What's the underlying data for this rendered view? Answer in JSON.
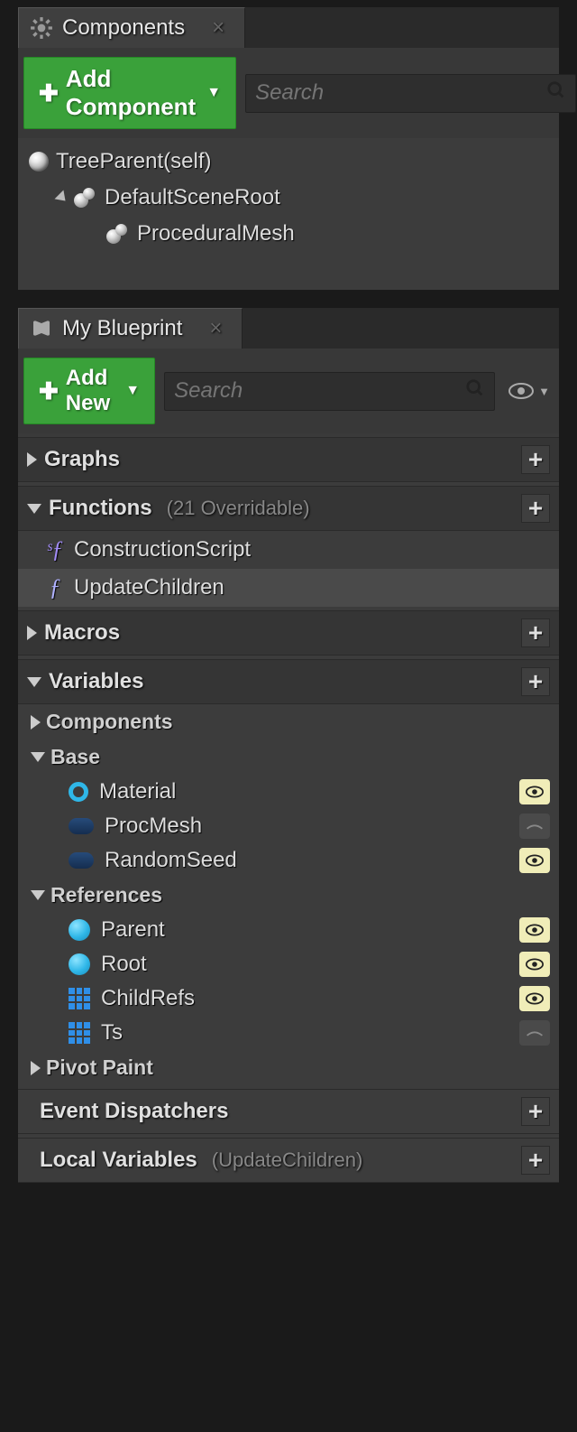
{
  "components_panel": {
    "tab_label": "Components",
    "add_button": "Add Component",
    "search_placeholder": "Search",
    "tree": {
      "root": "TreeParent(self)",
      "scene_root": "DefaultSceneRoot",
      "child": "ProceduralMesh"
    }
  },
  "blueprint_panel": {
    "tab_label": "My Blueprint",
    "add_button": "Add New",
    "search_placeholder": "Search",
    "sections": {
      "graphs": {
        "label": "Graphs"
      },
      "functions": {
        "label": "Functions",
        "meta": "(21 Overridable)",
        "items": [
          {
            "name": "ConstructionScript",
            "icon": "construct"
          },
          {
            "name": "UpdateChildren",
            "icon": "fn"
          }
        ]
      },
      "macros": {
        "label": "Macros"
      },
      "variables": {
        "label": "Variables",
        "groups": {
          "components": {
            "label": "Components"
          },
          "base": {
            "label": "Base",
            "vars": [
              {
                "name": "Material",
                "type": "ring",
                "color": "#2fb7e8",
                "visible": true
              },
              {
                "name": "ProcMesh",
                "type": "pill",
                "color": "#1f3f6f",
                "visible": false
              },
              {
                "name": "RandomSeed",
                "type": "pill",
                "color": "#1f3f6f",
                "visible": true
              }
            ]
          },
          "references": {
            "label": "References",
            "vars": [
              {
                "name": "Parent",
                "type": "sphere",
                "color": "#2fb7e8",
                "visible": true
              },
              {
                "name": "Root",
                "type": "sphere",
                "color": "#2fb7e8",
                "visible": true
              },
              {
                "name": "ChildRefs",
                "type": "grid",
                "color": "#2f8fe8",
                "visible": true
              },
              {
                "name": "Ts",
                "type": "grid",
                "color": "#2f8fe8",
                "visible": false
              }
            ]
          },
          "pivot_paint": {
            "label": "Pivot Paint"
          }
        }
      },
      "event_dispatchers": {
        "label": "Event Dispatchers"
      },
      "local_variables": {
        "label": "Local Variables",
        "meta": "(UpdateChildren)"
      }
    }
  }
}
